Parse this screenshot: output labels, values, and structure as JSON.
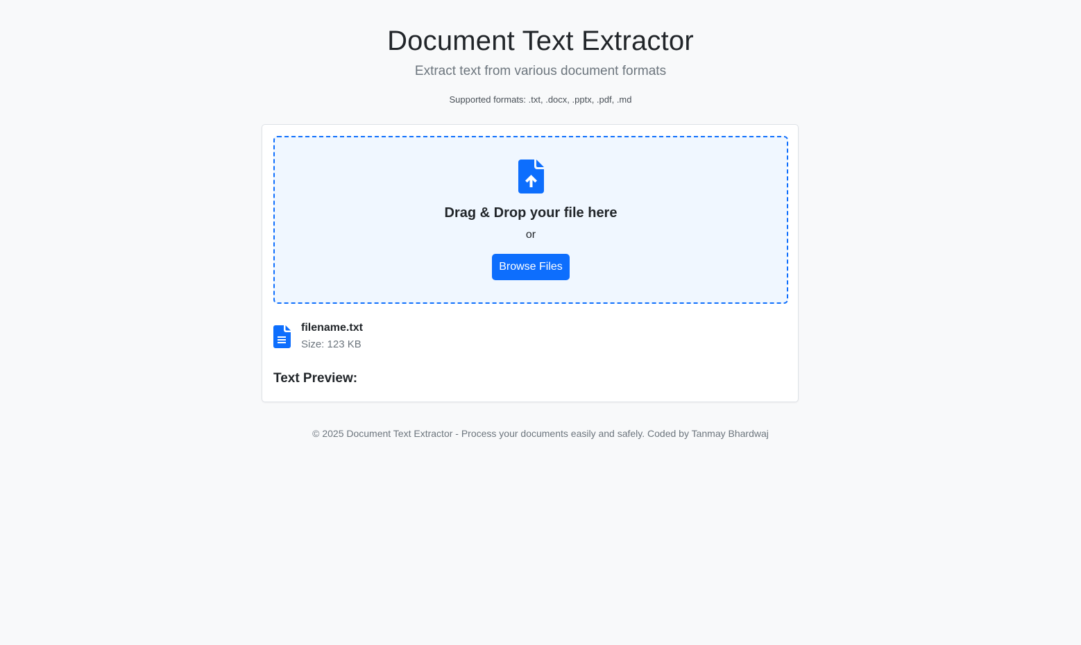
{
  "header": {
    "title": "Document Text Extractor",
    "subtitle": "Extract text from various document formats",
    "supported_formats": "Supported formats: .txt, .docx, .pptx, .pdf, .md"
  },
  "dropzone": {
    "icon": "file-upload-icon",
    "title": "Drag & Drop your file here",
    "or_text": "or",
    "browse_label": "Browse Files"
  },
  "file": {
    "icon": "file-text-icon",
    "name": "filename.txt",
    "size": "Size: 123 KB"
  },
  "preview": {
    "heading": "Text Preview:"
  },
  "footer": {
    "text": "© 2025 Document Text Extractor - Process your documents easily and safely. Coded by Tanmay Bhardwaj"
  },
  "colors": {
    "accent": "#0d6efd",
    "background": "#f8f9fa",
    "dropzone_bg": "#f0f7ff",
    "muted_text": "#6c757d"
  }
}
